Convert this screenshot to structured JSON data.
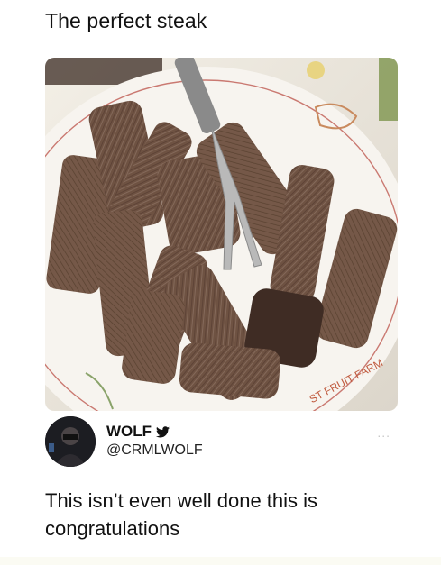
{
  "post": {
    "title": "The perfect steak",
    "image": {
      "icon": "steak-photo",
      "plate_text": "ST FRUIT FARM"
    }
  },
  "tweet": {
    "display_name": "WOLF",
    "verified_icon": "twitter-bird-icon",
    "handle": "@CRMLWOLF",
    "more_icon": "more-dots-icon",
    "more_glyph": "...",
    "text": "This isn’t even well done this is congratulations"
  },
  "colors": {
    "background": "#ffffff",
    "text": "#111111",
    "steak": "#6e5242"
  }
}
